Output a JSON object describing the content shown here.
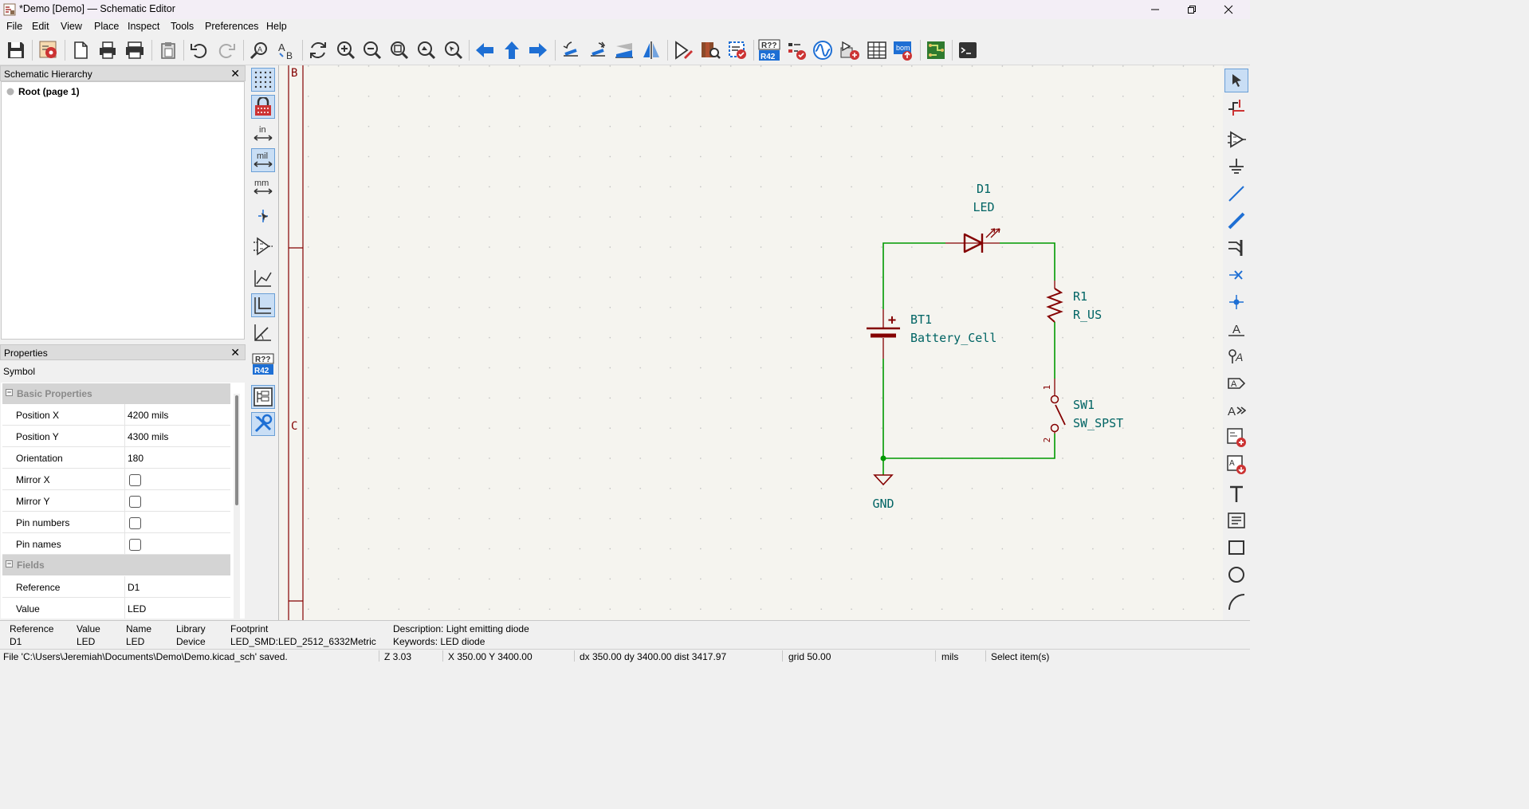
{
  "window": {
    "title": "*Demo [Demo] — Schematic Editor"
  },
  "menu": [
    "File",
    "Edit",
    "View",
    "Place",
    "Inspect",
    "Tools",
    "Preferences",
    "Help"
  ],
  "toolbar": {
    "icons": [
      "save-icon",
      "schematic-setup-icon",
      "page-settings-icon",
      "print-icon",
      "plot-icon",
      "paste-icon",
      "undo-icon",
      "redo-icon",
      "find-icon",
      "find-replace-icon",
      "refresh-icon",
      "zoom-in-icon",
      "zoom-out-icon",
      "zoom-fit-icon",
      "zoom-objects-icon",
      "zoom-selection-icon",
      "navigate-back-icon",
      "navigate-up-icon",
      "navigate-forward-icon",
      "rotate-ccw-icon",
      "rotate-cw-icon",
      "mirror-vertical-icon",
      "mirror-horizontal-icon",
      "symbol-editor-icon",
      "symbol-browser-icon",
      "annotate-icon",
      "erc-icon",
      "simulator-icon",
      "assign-footprints-icon",
      "symbol-fields-table-icon",
      "bom-icon",
      "pcb-editor-icon",
      "scripting-console-icon"
    ],
    "annotate_badge_top": "R??",
    "annotate_badge_bottom": "R42",
    "bom_badge": "bom"
  },
  "hierarchy": {
    "title": "Schematic Hierarchy",
    "items": [
      {
        "label": "Root (page 1)"
      }
    ]
  },
  "properties": {
    "title": "Properties",
    "type": "Symbol",
    "groups": [
      {
        "name": "Basic Properties"
      },
      {
        "name": "Fields"
      }
    ],
    "rows": [
      {
        "label": "Position X",
        "value": "4200 mils"
      },
      {
        "label": "Position Y",
        "value": "4300 mils"
      },
      {
        "label": "Orientation",
        "value": "180"
      },
      {
        "label": "Mirror X",
        "checked": false
      },
      {
        "label": "Mirror Y",
        "checked": false
      },
      {
        "label": "Pin numbers",
        "checked": false
      },
      {
        "label": "Pin names",
        "checked": false
      },
      {
        "label": "Reference",
        "value": "D1"
      },
      {
        "label": "Value",
        "value": "LED"
      }
    ]
  },
  "left_toolbar": {
    "unit_in": "in",
    "unit_mil": "mil",
    "unit_mm": "mm",
    "annotate_top": "R??",
    "annotate_bottom": "R42",
    "selected_unit": "mil"
  },
  "schematic": {
    "border_labels": [
      "B",
      "C"
    ],
    "components": [
      {
        "ref": "D1",
        "value": "LED"
      },
      {
        "ref": "R1",
        "value": "R_US"
      },
      {
        "ref": "BT1",
        "value": "Battery_Cell"
      },
      {
        "ref": "SW1",
        "value": "SW_SPST"
      }
    ],
    "power": {
      "label": "GND"
    },
    "battery_plus": "+",
    "sw_pin1": "1",
    "sw_pin2": "2",
    "colors": {
      "wire": "#009900",
      "symbol": "#840000",
      "text": "#006464",
      "grid": "#b4b4b4",
      "background": "#f5f4ef"
    }
  },
  "right_toolbar": {
    "icons": [
      "select-icon",
      "highlight-net-icon",
      "add-symbol-icon",
      "add-power-icon",
      "add-wire-icon",
      "add-bus-icon",
      "add-bus-entry-icon",
      "no-connect-icon",
      "add-junction-icon",
      "add-label-icon",
      "add-net-class-icon",
      "add-global-label-icon",
      "add-hierarchical-label-icon",
      "add-sheet-icon",
      "import-sheet-pin-icon",
      "add-text-icon",
      "add-textbox-icon",
      "add-rectangle-icon",
      "add-circle-icon",
      "add-arc-icon"
    ]
  },
  "message_panel": {
    "columns": [
      {
        "header": "Reference",
        "value": "D1"
      },
      {
        "header": "Value",
        "value": "LED"
      },
      {
        "header": "Name",
        "value": "LED"
      },
      {
        "header": "Library",
        "value": "Device"
      },
      {
        "header": "Footprint",
        "value": "LED_SMD:LED_2512_6332Metric"
      }
    ],
    "description": "Description: Light emitting diode",
    "keywords": "Keywords: LED diode"
  },
  "status": {
    "message": "File 'C:\\Users\\Jeremiah\\Documents\\Demo\\Demo.kicad_sch' saved.",
    "zoom": "Z 3.03",
    "cursor": "X 350.00  Y 3400.00",
    "delta": "dx 350.00  dy 3400.00  dist 3417.97",
    "grid": "grid 50.00",
    "units": "mils",
    "tool": "Select item(s)"
  }
}
